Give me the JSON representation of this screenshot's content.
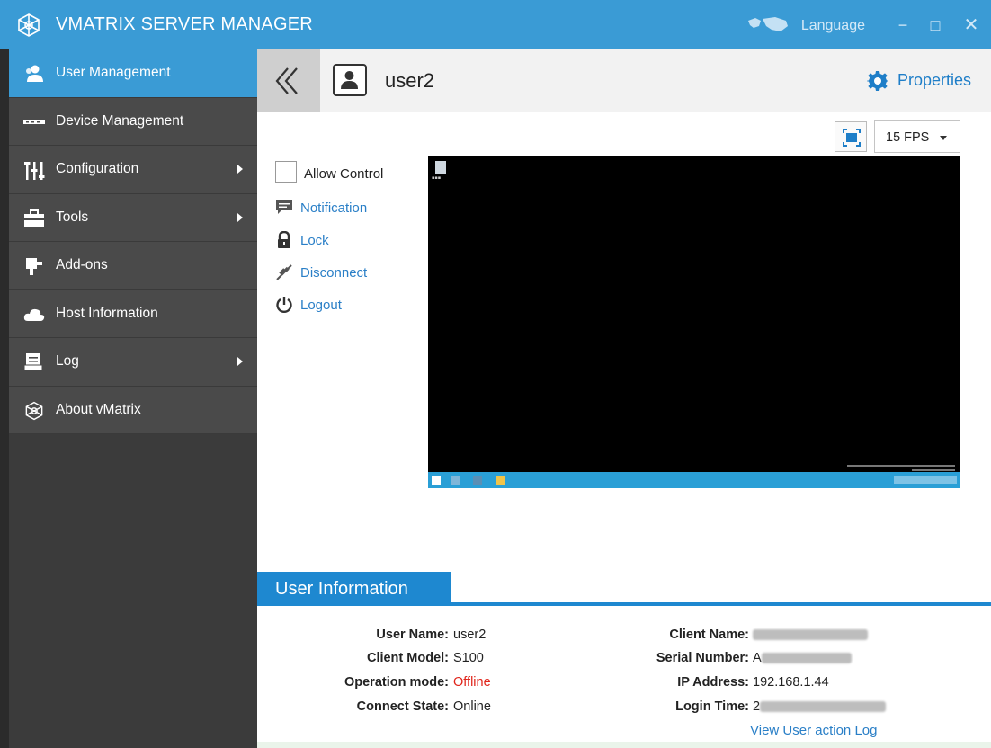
{
  "titlebar": {
    "title": "VMATRIX SERVER MANAGER",
    "language_label": "Language",
    "minimize_symbol": "−",
    "maximize_symbol": "□",
    "close_symbol": "✕",
    "accent_color": "#3a9bd5"
  },
  "sidebar": {
    "items": [
      {
        "label": "User Management",
        "icon": "users-icon",
        "active": true,
        "has_submenu": false
      },
      {
        "label": "Device Management",
        "icon": "device-icon",
        "active": false,
        "has_submenu": false
      },
      {
        "label": "Configuration",
        "icon": "sliders-icon",
        "active": false,
        "has_submenu": true
      },
      {
        "label": "Tools",
        "icon": "toolbox-icon",
        "active": false,
        "has_submenu": true
      },
      {
        "label": "Add-ons",
        "icon": "plugin-icon",
        "active": false,
        "has_submenu": false
      },
      {
        "label": "Host Information",
        "icon": "cloud-icon",
        "active": false,
        "has_submenu": false
      },
      {
        "label": "Log",
        "icon": "log-icon",
        "active": false,
        "has_submenu": true
      },
      {
        "label": "About vMatrix",
        "icon": "vmatrix-logo-icon",
        "active": false,
        "has_submenu": false
      }
    ]
  },
  "header": {
    "user_name": "user2",
    "properties_label": "Properties"
  },
  "viewer": {
    "fps_selected": "15 FPS",
    "allow_control_label": "Allow Control",
    "allow_control_checked": false,
    "actions": [
      {
        "label": "Notification",
        "icon": "notification-icon"
      },
      {
        "label": "Lock",
        "icon": "lock-icon"
      },
      {
        "label": "Disconnect",
        "icon": "disconnect-icon"
      },
      {
        "label": "Logout",
        "icon": "power-icon"
      }
    ]
  },
  "user_info": {
    "tab_label": "User Information",
    "left": [
      {
        "key": "User Name:",
        "value": "user2"
      },
      {
        "key": "Client Model:",
        "value": "S100"
      },
      {
        "key": "Operation mode:",
        "value": "Offline",
        "status_color": "#e0251b"
      },
      {
        "key": "Connect State:",
        "value": "Online"
      }
    ],
    "right": [
      {
        "key": "Client Name:",
        "value": "",
        "redacted": true
      },
      {
        "key": "Serial Number:",
        "value": "A",
        "redacted": true
      },
      {
        "key": "IP Address:",
        "value": "192.168.1.44"
      },
      {
        "key": "Login Time:",
        "value": "2",
        "redacted": true
      }
    ],
    "view_log_label": "View User action Log"
  }
}
